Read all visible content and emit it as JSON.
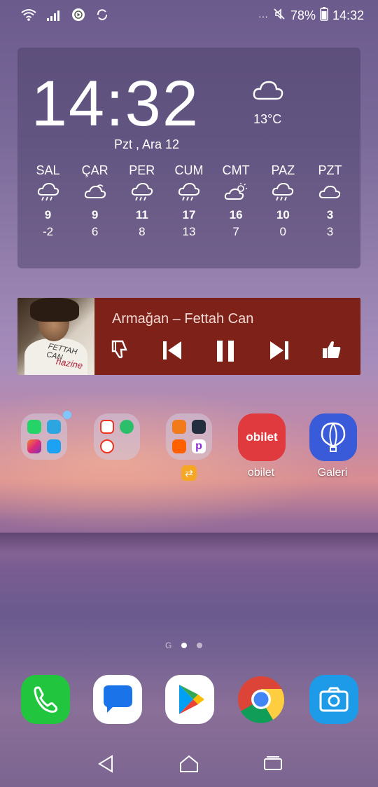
{
  "status_bar": {
    "battery": "78%",
    "time": "14:32",
    "more": "···",
    "icons": [
      "wifi-icon",
      "signal-icon",
      "play-circle-icon",
      "sync-icon",
      "mute-icon",
      "battery-icon"
    ]
  },
  "weather": {
    "clock": "14:32",
    "temperature": "13°C",
    "date": "Pzt , Ara 12",
    "forecast": [
      {
        "day": "SAL",
        "icon": "rain-cloud",
        "high": "9",
        "low": "-2"
      },
      {
        "day": "ÇAR",
        "icon": "partly-cloudy",
        "high": "9",
        "low": "6"
      },
      {
        "day": "PER",
        "icon": "rain-cloud",
        "high": "11",
        "low": "8"
      },
      {
        "day": "CUM",
        "icon": "rain-cloud",
        "high": "17",
        "low": "13"
      },
      {
        "day": "CMT",
        "icon": "sun-cloud",
        "high": "16",
        "low": "7"
      },
      {
        "day": "PAZ",
        "icon": "rain-cloud",
        "high": "10",
        "low": "0"
      },
      {
        "day": "PZT",
        "icon": "cloud",
        "high": "3",
        "low": "3"
      }
    ]
  },
  "music": {
    "track": "Armağan – Fettah Can",
    "album_text_1": "FETTAH CAN",
    "album_text_2": "hazine",
    "controls": [
      "thumbs-down-icon",
      "previous-icon",
      "pause-icon",
      "next-icon",
      "thumbs-up-icon"
    ],
    "color": "#7e2118"
  },
  "apps": [
    {
      "label": "",
      "type": "folder-social"
    },
    {
      "label": "",
      "type": "folder-media"
    },
    {
      "label": "",
      "type": "folder-shopping"
    },
    {
      "label": "obilet",
      "type": "obilet",
      "color": "#e03a3e"
    },
    {
      "label": "Galeri",
      "type": "gallery",
      "color": "#3a5bd9"
    }
  ],
  "page_indicator": {
    "g_label": "G",
    "pages": 2,
    "active": 0
  },
  "dock": [
    "phone",
    "messages",
    "play-store",
    "chrome",
    "camera"
  ],
  "nav": [
    "back-icon",
    "home-icon",
    "recents-icon"
  ]
}
